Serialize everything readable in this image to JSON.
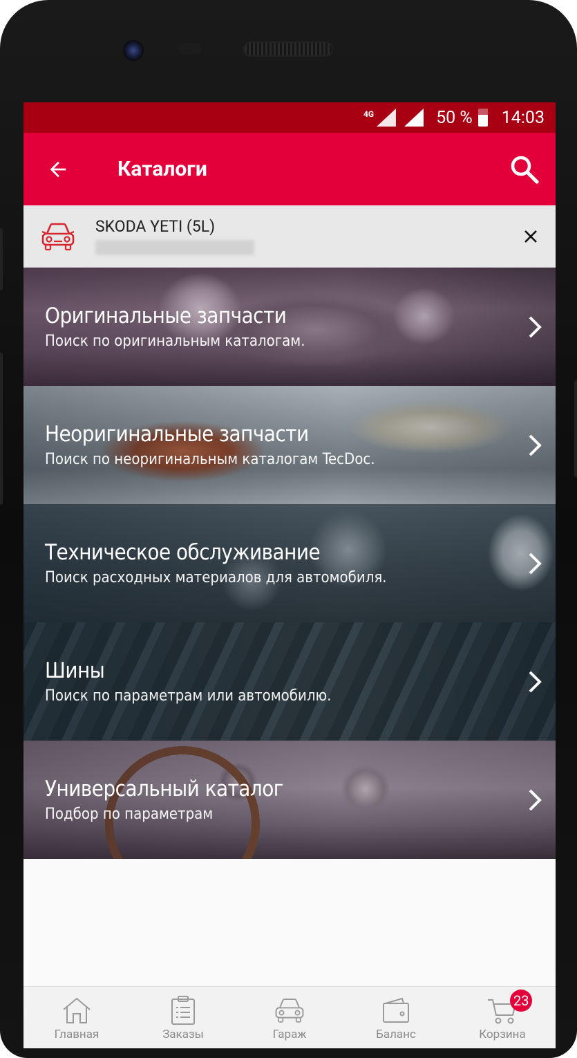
{
  "status_bar": {
    "network": "4G",
    "battery_percent": "50 %",
    "time": "14:03"
  },
  "app_bar": {
    "title": "Каталоги",
    "back_icon": "arrow-back-icon",
    "search_icon": "search-icon"
  },
  "vehicle": {
    "name": "SKODA YETI (5L)",
    "icon": "car-icon"
  },
  "catalogs": [
    {
      "title": "Оригинальные запчасти",
      "subtitle": "Поиск по оригинальным каталогам."
    },
    {
      "title": "Неоригинальные запчасти",
      "subtitle": "Поиск по неоригинальным каталогам TecDoc."
    },
    {
      "title": "Техническое обслуживание",
      "subtitle": "Поиск расходных материалов для автомобиля."
    },
    {
      "title": "Шины",
      "subtitle": "Поиск по параметрам или автомобилю."
    },
    {
      "title": "Универсальный каталог",
      "subtitle": "Подбор по параметрам"
    }
  ],
  "bottom_nav": [
    {
      "label": "Главная",
      "icon": "home-icon"
    },
    {
      "label": "Заказы",
      "icon": "clipboard-icon"
    },
    {
      "label": "Гараж",
      "icon": "car-icon"
    },
    {
      "label": "Баланс",
      "icon": "wallet-icon"
    },
    {
      "label": "Корзина",
      "icon": "cart-icon",
      "badge": "23"
    }
  ],
  "colors": {
    "status_bar": "#a80012",
    "app_bar": "#e3003a",
    "badge": "#e3003a"
  }
}
